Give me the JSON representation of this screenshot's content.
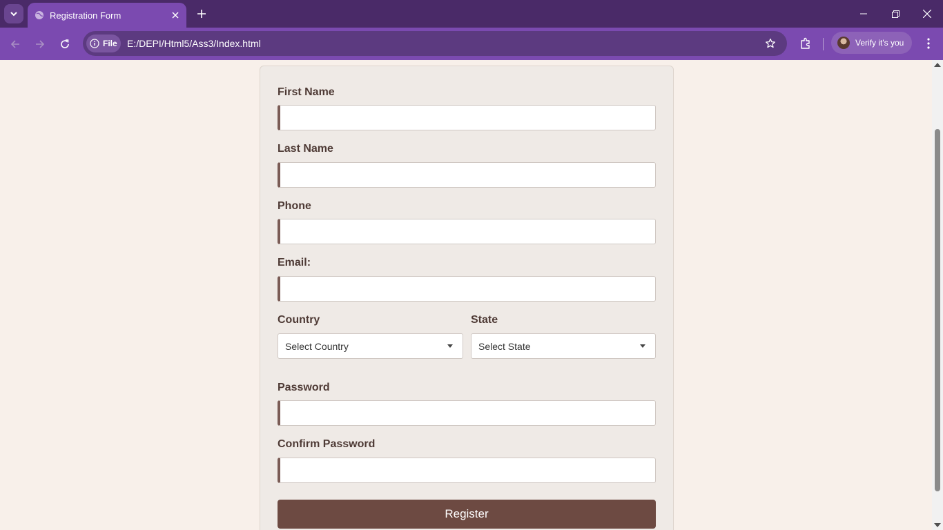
{
  "browser": {
    "tab_title": "Registration Form",
    "site_chip_label": "File",
    "url": "E:/DEPI/Html5/Ass3/Index.html",
    "profile_label": "Verify it's you",
    "theme_colors": {
      "tabbar": "#4a2a68",
      "toolbar": "#7b4ab0"
    },
    "icons": [
      "tab-search-icon",
      "globe-icon",
      "close-icon",
      "plus-icon",
      "minimize-icon",
      "restore-icon",
      "back-icon",
      "forward-icon",
      "reload-icon",
      "info-icon",
      "star-icon",
      "extensions-icon",
      "more-vert-icon"
    ]
  },
  "form": {
    "first_name_label": "First Name",
    "last_name_label": "Last Name",
    "phone_label": "Phone",
    "email_label": "Email:",
    "country_label": "Country",
    "country_selected": "Select Country",
    "state_label": "State",
    "state_selected": "Select State",
    "password_label": "Password",
    "confirm_password_label": "Confirm Password",
    "register_label": "Register",
    "colors": {
      "accent": "#6d4a42",
      "label": "#4e3a35",
      "page_bg": "#f8f0ea",
      "card_bg": "#efeae6"
    }
  }
}
